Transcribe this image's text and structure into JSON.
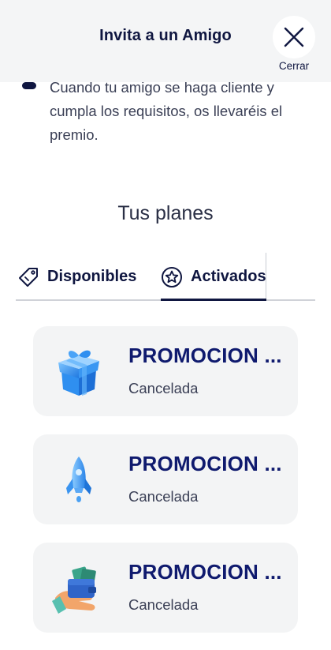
{
  "header": {
    "title": "Invita a un Amigo",
    "close_label": "Cerrar"
  },
  "info": {
    "bullet_text": "Cuando tu amigo se haga cliente y cumpla los requisitos, os llevaréis el premio."
  },
  "plans": {
    "title": "Tus planes",
    "tabs": [
      {
        "label": "Disponibles",
        "icon": "tag-icon",
        "active": false
      },
      {
        "label": "Activados",
        "icon": "star-badge-icon",
        "active": true
      }
    ],
    "cards": [
      {
        "title": "PROMOCION ...",
        "status": "Cancelada",
        "icon": "gift-box-icon"
      },
      {
        "title": "PROMOCION ...",
        "status": "Cancelada",
        "icon": "rocket-icon"
      },
      {
        "title": "PROMOCION ...",
        "status": "Cancelada",
        "icon": "wallet-hand-icon"
      }
    ]
  },
  "colors": {
    "primary": "#0f1640",
    "title_blue": "#0f1a6e",
    "card_bg": "#f3f4f5",
    "header_bg": "#f4f5f6"
  }
}
